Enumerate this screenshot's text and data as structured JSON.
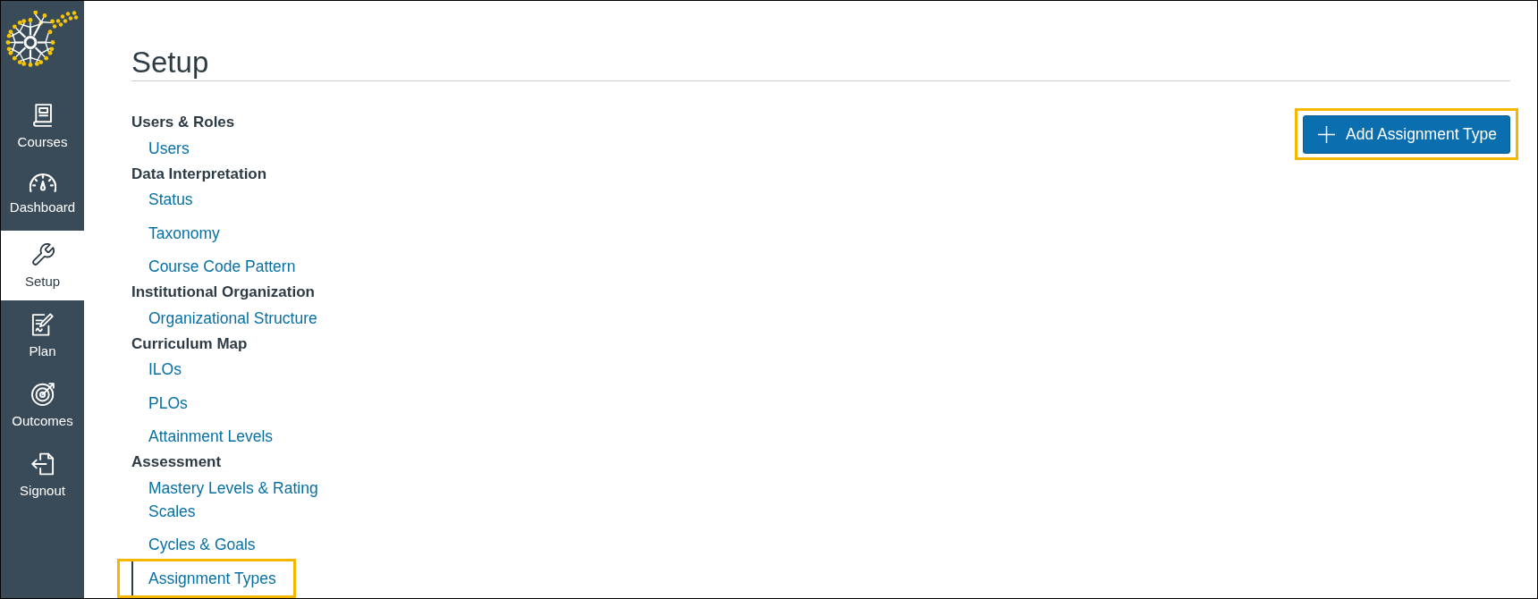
{
  "sidebar": {
    "items": [
      {
        "label": "Courses",
        "selected": false
      },
      {
        "label": "Dashboard",
        "selected": false
      },
      {
        "label": "Setup",
        "selected": true
      },
      {
        "label": "Plan",
        "selected": false
      },
      {
        "label": "Outcomes",
        "selected": false
      },
      {
        "label": "Signout",
        "selected": false
      }
    ]
  },
  "page": {
    "title": "Setup"
  },
  "add_button": {
    "label": "Add Assignment Type",
    "highlighted": true
  },
  "sections": [
    {
      "heading": "Users & Roles",
      "links": [
        {
          "label": "Users",
          "selected": false,
          "highlighted": false
        }
      ]
    },
    {
      "heading": "Data Interpretation",
      "links": [
        {
          "label": "Status",
          "selected": false,
          "highlighted": false
        },
        {
          "label": "Taxonomy",
          "selected": false,
          "highlighted": false
        },
        {
          "label": "Course Code Pattern",
          "selected": false,
          "highlighted": false
        }
      ]
    },
    {
      "heading": "Institutional Organization",
      "links": [
        {
          "label": "Organizational Structure",
          "selected": false,
          "highlighted": false
        }
      ]
    },
    {
      "heading": "Curriculum Map",
      "links": [
        {
          "label": "ILOs",
          "selected": false,
          "highlighted": false
        },
        {
          "label": "PLOs",
          "selected": false,
          "highlighted": false
        },
        {
          "label": "Attainment Levels",
          "selected": false,
          "highlighted": false
        }
      ]
    },
    {
      "heading": "Assessment",
      "links": [
        {
          "label": "Mastery Levels & Rating Scales",
          "selected": false,
          "highlighted": false
        },
        {
          "label": "Cycles & Goals",
          "selected": false,
          "highlighted": false
        },
        {
          "label": "Assignment Types",
          "selected": true,
          "highlighted": true
        }
      ]
    }
  ]
}
